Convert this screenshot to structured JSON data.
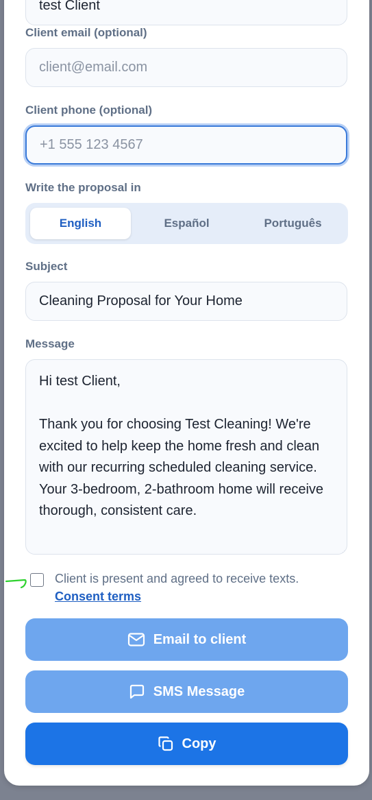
{
  "form": {
    "client_name_value": "test Client",
    "client_email": {
      "label": "Client email (optional)",
      "placeholder": "client@email.com"
    },
    "client_phone": {
      "label": "Client phone (optional)",
      "placeholder": "+1 555 123 4567"
    },
    "language": {
      "label": "Write the proposal in",
      "options": [
        "English",
        "Español",
        "Português"
      ],
      "selected": "English"
    },
    "subject": {
      "label": "Subject",
      "value": "Cleaning Proposal for Your Home"
    },
    "message": {
      "label": "Message",
      "value": "Hi test Client,\n\nThank you for choosing Test Cleaning! We're excited to help keep the home fresh and clean with our recurring scheduled cleaning service. Your 3-bedroom, 2-bathroom home will receive thorough, consistent care."
    },
    "consent": {
      "text": "Client is present and agreed to receive texts.",
      "link": "Consent terms",
      "checked": false
    }
  },
  "actions": {
    "email_label": "Email to client",
    "sms_label": "SMS Message",
    "copy_label": "Copy"
  },
  "icons": {
    "email": "mail-icon",
    "sms": "message-square-icon",
    "copy": "copy-icon"
  },
  "colors": {
    "primary": "#1c74e6",
    "primary_light": "#6ea6ee",
    "link": "#1f5fc2",
    "label": "#5f6f86",
    "focus_ring": "#3a7ad9",
    "cursor_annotation": "#2ed12e"
  }
}
